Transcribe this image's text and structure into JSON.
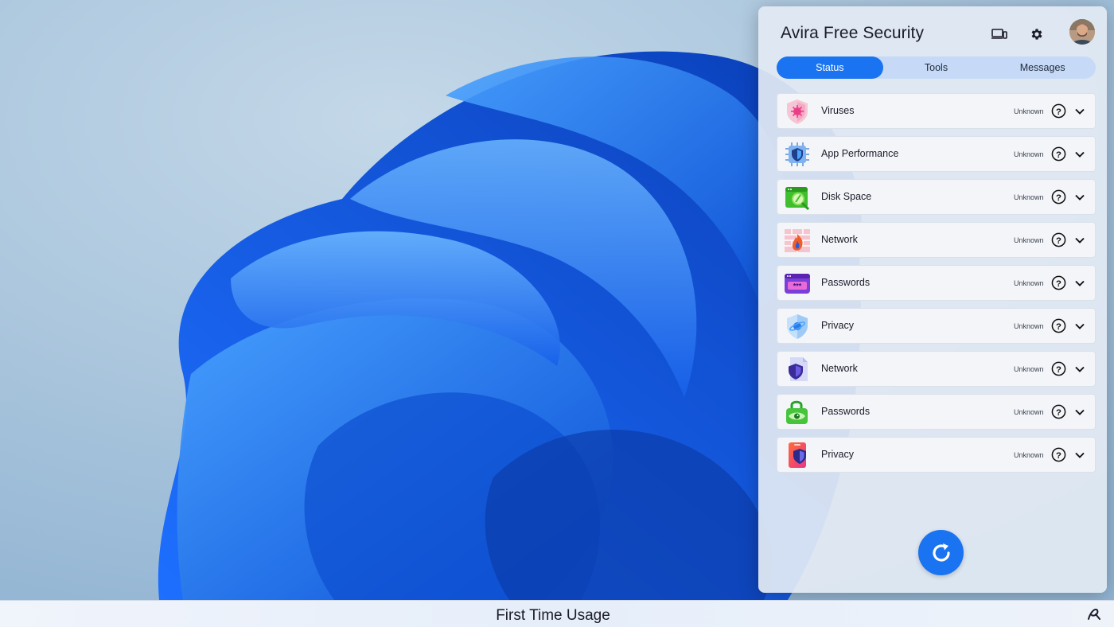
{
  "app": {
    "title": "Avira Free Security",
    "accent": "#1a73f0"
  },
  "header": {
    "devices_icon": "devices-icon",
    "settings_icon": "gear-icon",
    "avatar": "user-avatar"
  },
  "tabs": [
    {
      "label": "Status",
      "active": true
    },
    {
      "label": "Tools",
      "active": false
    },
    {
      "label": "Messages",
      "active": false
    }
  ],
  "items": [
    {
      "label": "Viruses",
      "status": "Unknown",
      "icon": "virus-shield-icon"
    },
    {
      "label": "App Performance",
      "status": "Unknown",
      "icon": "chip-shield-icon"
    },
    {
      "label": "Disk Space",
      "status": "Unknown",
      "icon": "disk-search-icon"
    },
    {
      "label": "Network",
      "status": "Unknown",
      "icon": "firewall-icon"
    },
    {
      "label": "Passwords",
      "status": "Unknown",
      "icon": "password-field-icon"
    },
    {
      "label": "Privacy",
      "status": "Unknown",
      "icon": "privacy-shield-icon"
    },
    {
      "label": "Network",
      "status": "Unknown",
      "icon": "document-shield-icon"
    },
    {
      "label": "Passwords",
      "status": "Unknown",
      "icon": "padlock-eye-icon"
    },
    {
      "label": "Privacy",
      "status": "Unknown",
      "icon": "phone-shield-icon"
    }
  ],
  "refresh_icon": "refresh-icon",
  "bottom_bar": {
    "title": "First Time Usage",
    "logo_icon": "avira-logo-icon"
  }
}
